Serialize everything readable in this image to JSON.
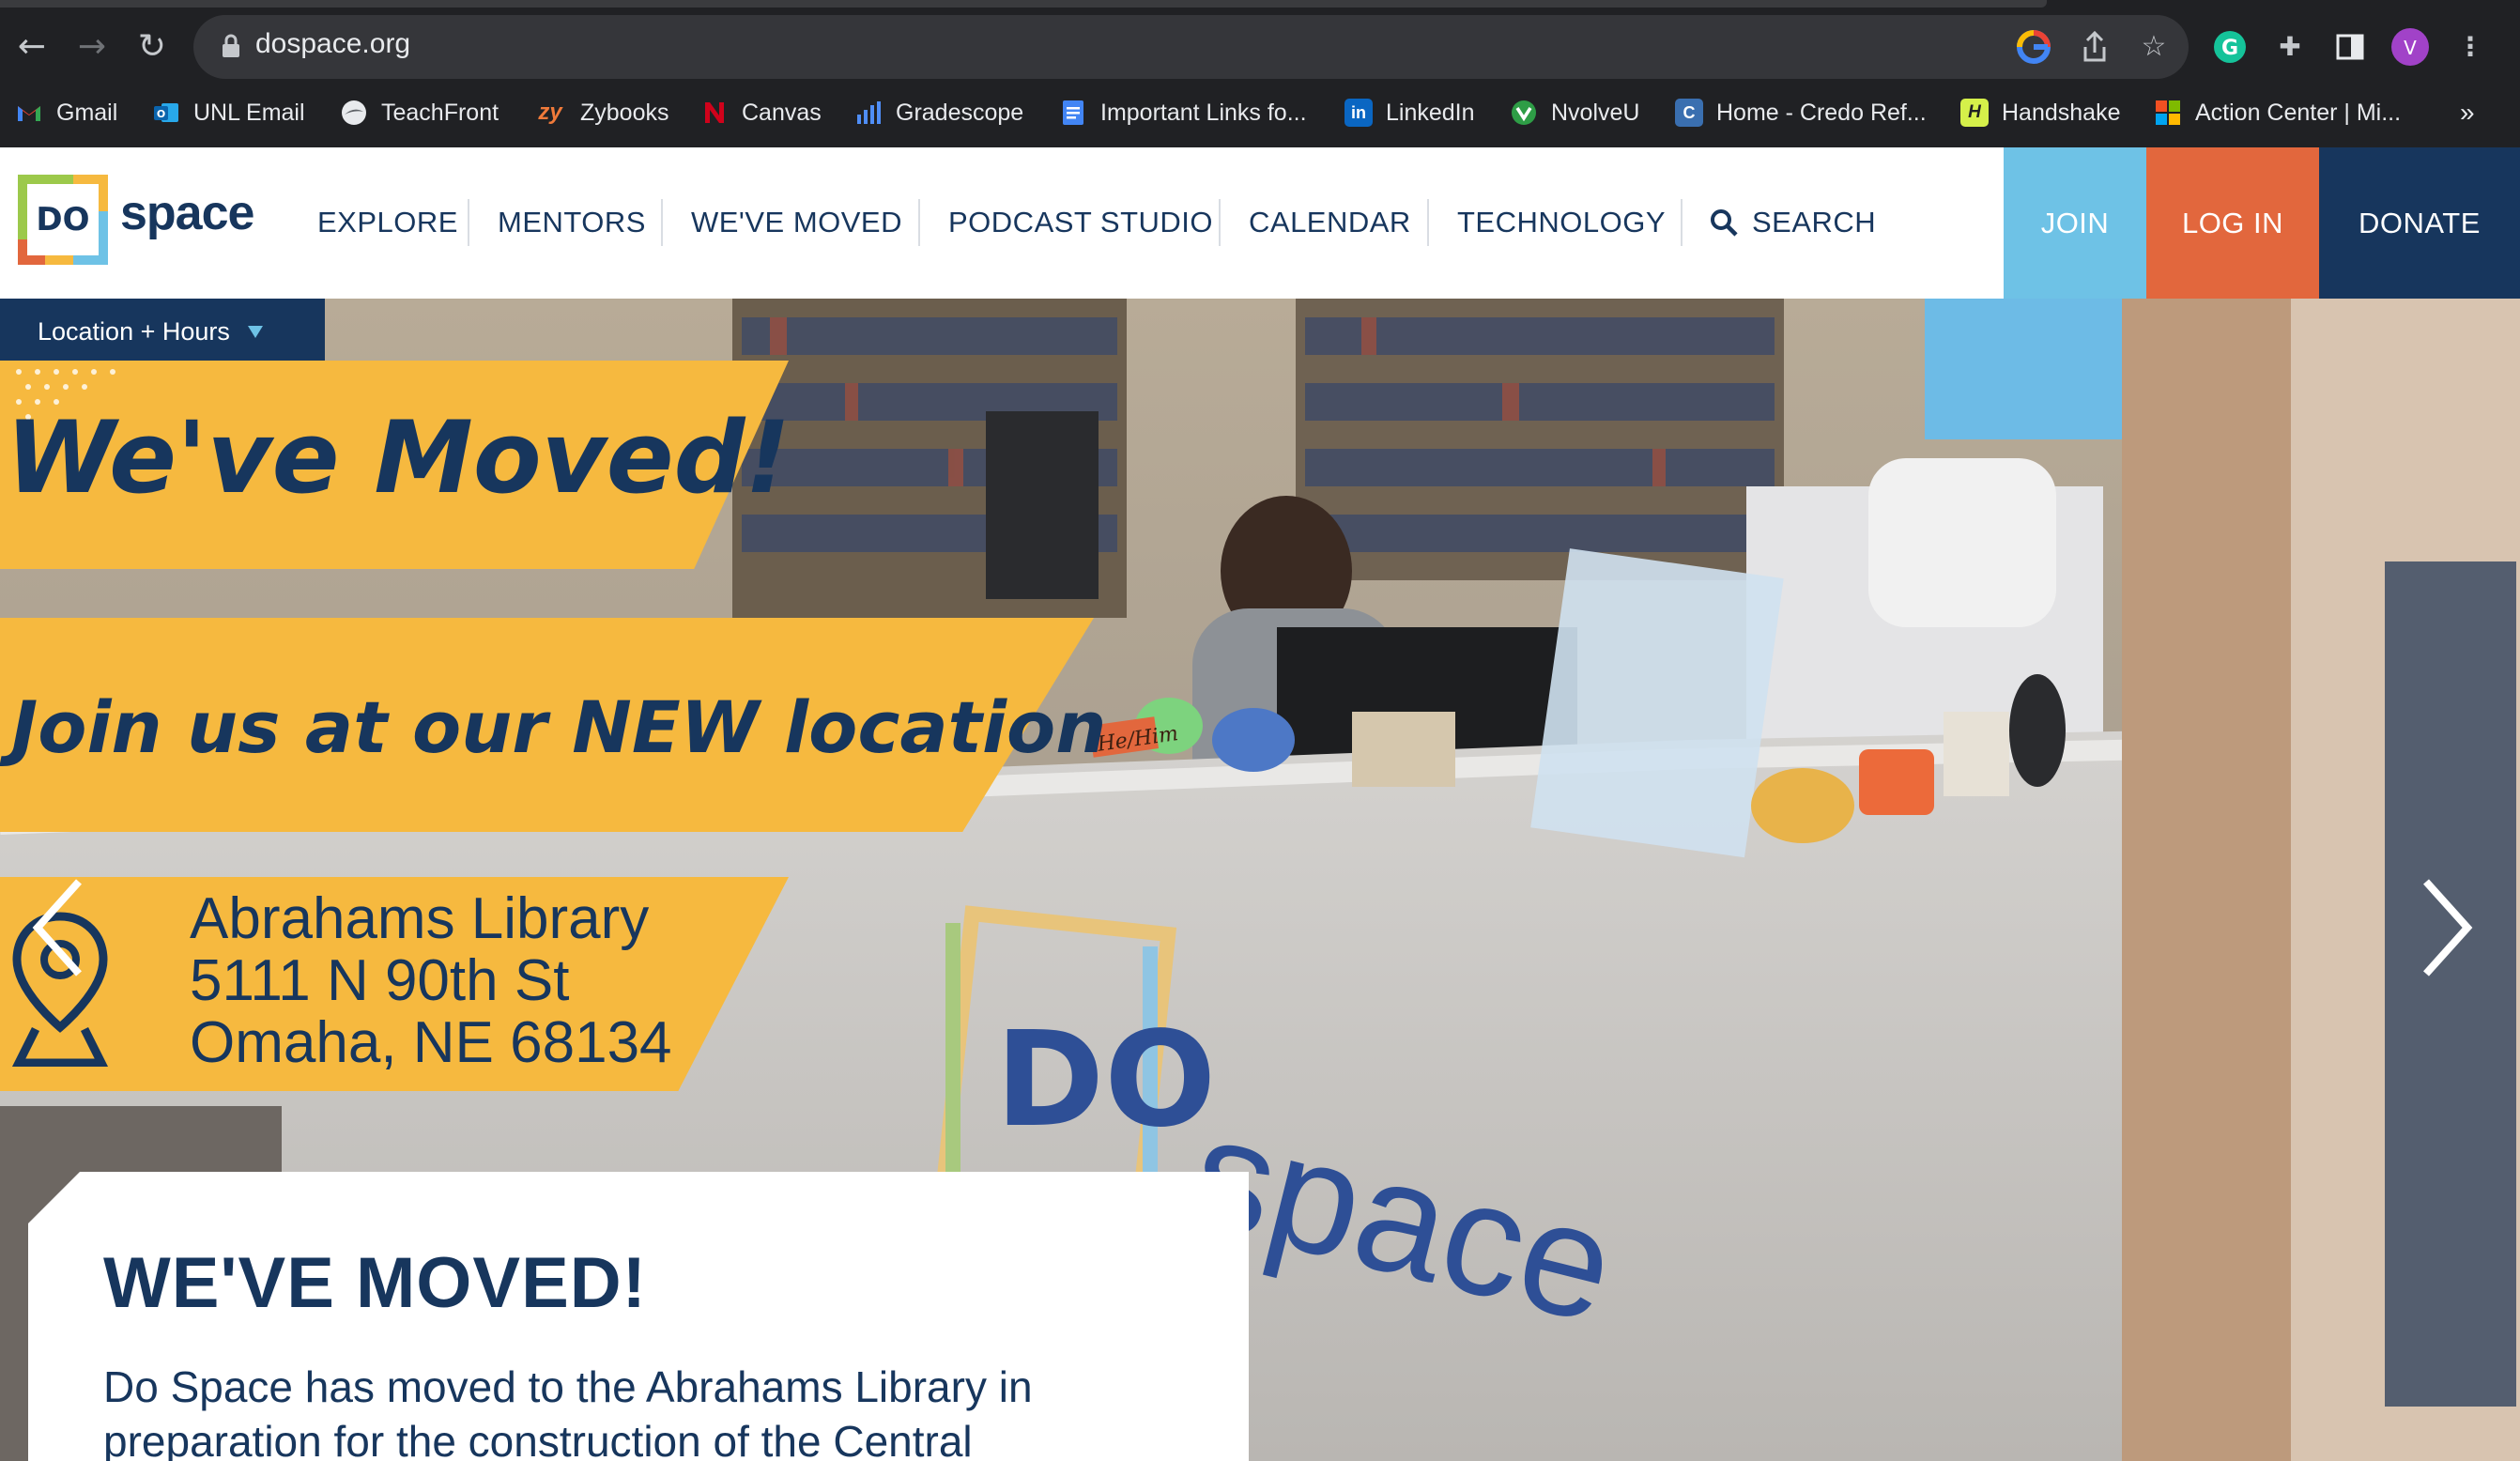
{
  "browser": {
    "url": "dospace.org",
    "profile_initial": "V",
    "bookmarks": [
      {
        "label": "Gmail",
        "icon": "gmail-icon"
      },
      {
        "label": "UNL Email",
        "icon": "outlook-icon"
      },
      {
        "label": "TeachFront",
        "icon": "teachfront-icon"
      },
      {
        "label": "Zybooks",
        "icon": "zybooks-icon"
      },
      {
        "label": "Canvas",
        "icon": "canvas-icon"
      },
      {
        "label": "Gradescope",
        "icon": "gradescope-icon"
      },
      {
        "label": "Important Links fo...",
        "icon": "docs-icon"
      },
      {
        "label": "LinkedIn",
        "icon": "linkedin-icon"
      },
      {
        "label": "NvolveU",
        "icon": "nvolveu-icon"
      },
      {
        "label": "Home - Credo Ref...",
        "icon": "credo-icon"
      },
      {
        "label": "Handshake",
        "icon": "handshake-icon"
      },
      {
        "label": "Action Center | Mi...",
        "icon": "microsoft-icon"
      }
    ],
    "more_bookmarks": "»",
    "zybooks_glyph": "zy",
    "linkedin_glyph": "in",
    "handshake_glyph": "H",
    "credo_glyph": "C"
  },
  "site": {
    "logo_text": "space",
    "logo_mark": "DO",
    "nav": [
      "EXPLORE",
      "MENTORS",
      "WE'VE MOVED",
      "PODCAST STUDIO",
      "CALENDAR",
      "TECHNOLOGY",
      "SEARCH"
    ],
    "join": "JOIN",
    "login": "LOG IN",
    "donate": "DONATE",
    "colors": {
      "navy": "#17365d",
      "join": "#6ec2e6",
      "login": "#e2673d",
      "donate": "#17365d",
      "banner": "#f6b93f"
    }
  },
  "hero": {
    "location_button": "Location + Hours",
    "headline": "We've Moved!",
    "subheadline": "Join us at our NEW location",
    "address_lines": [
      "Abrahams Library",
      "5111 N 90th St",
      "Omaha, NE 68134"
    ],
    "desk_nameplate": "He/Him",
    "desk_logo_text": "space"
  },
  "card": {
    "title": "WE'VE MOVED!",
    "body": "Do Space has moved to the Abrahams Library in preparation for the construction of the Central"
  }
}
